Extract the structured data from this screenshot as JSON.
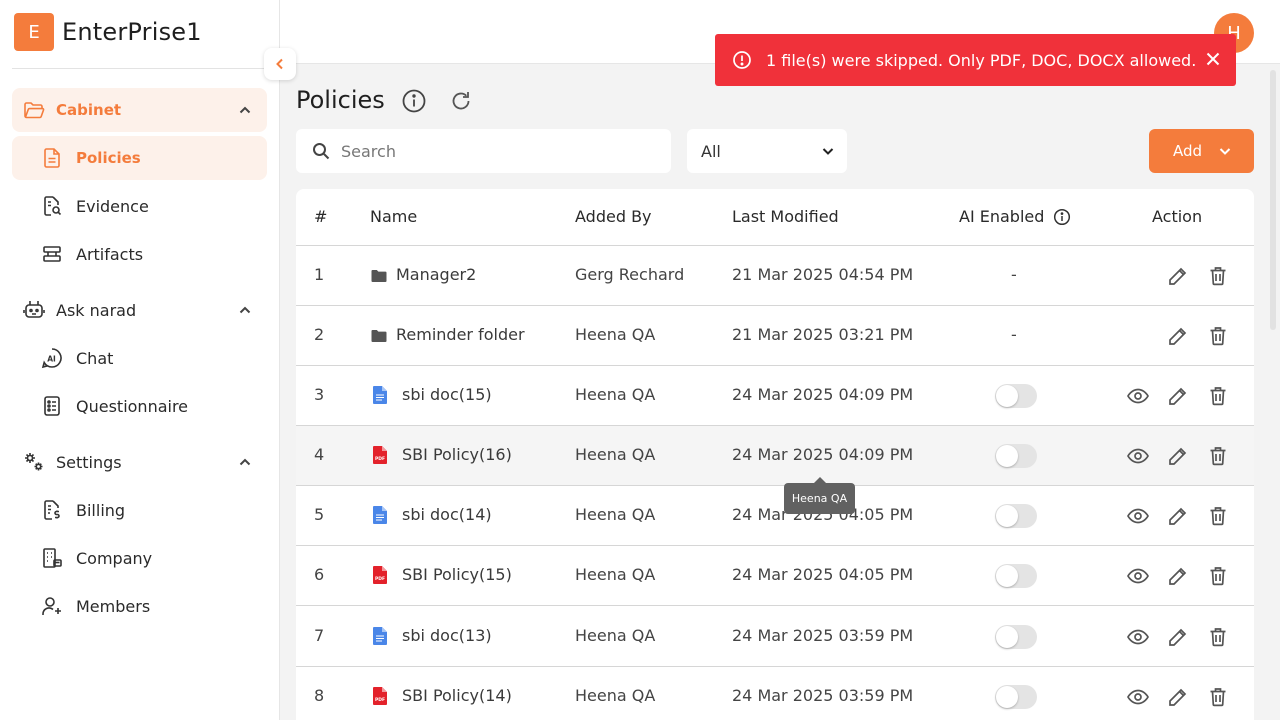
{
  "brand": {
    "logo_letter": "E",
    "name": "EnterPrise1"
  },
  "sidebar": {
    "groups": [
      {
        "label": "Cabinet",
        "items": [
          "Policies",
          "Evidence",
          "Artifacts"
        ]
      },
      {
        "label": "Ask narad",
        "items": [
          "Chat",
          "Questionnaire"
        ]
      },
      {
        "label": "Settings",
        "items": [
          "Billing",
          "Company",
          "Members"
        ]
      }
    ],
    "active_item": "Policies"
  },
  "header": {
    "avatar_letter": "H"
  },
  "toast": {
    "message": "1 file(s) were skipped. Only PDF, DOC, DOCX allowed."
  },
  "page": {
    "title": "Policies"
  },
  "filters": {
    "search_placeholder": "Search",
    "type_selected": "All",
    "add_label": "Add"
  },
  "table": {
    "columns": [
      "#",
      "Name",
      "Added By",
      "Last Modified",
      "AI Enabled",
      "Action"
    ],
    "rows": [
      {
        "num": "1",
        "type": "folder",
        "name": "Manager2",
        "added_by": "Gerg Rechard",
        "modified": "21 Mar 2025 04:54 PM",
        "ai": "-"
      },
      {
        "num": "2",
        "type": "folder",
        "name": "Reminder folder",
        "added_by": "Heena QA",
        "modified": "21 Mar 2025 03:21 PM",
        "ai": "-"
      },
      {
        "num": "3",
        "type": "doc",
        "name": "sbi doc(15)",
        "added_by": "Heena QA",
        "modified": "24 Mar 2025 04:09 PM",
        "ai": false
      },
      {
        "num": "4",
        "type": "pdf",
        "name": "SBI Policy(16)",
        "added_by": "Heena QA",
        "modified": "24 Mar 2025 04:09 PM",
        "ai": false
      },
      {
        "num": "5",
        "type": "doc",
        "name": "sbi doc(14)",
        "added_by": "Heena QA",
        "modified": "24 Mar 2025 04:05 PM",
        "ai": false
      },
      {
        "num": "6",
        "type": "pdf",
        "name": "SBI Policy(15)",
        "added_by": "Heena QA",
        "modified": "24 Mar 2025 04:05 PM",
        "ai": false
      },
      {
        "num": "7",
        "type": "doc",
        "name": "sbi doc(13)",
        "added_by": "Heena QA",
        "modified": "24 Mar 2025 03:59 PM",
        "ai": false
      },
      {
        "num": "8",
        "type": "pdf",
        "name": "SBI Policy(14)",
        "added_by": "Heena QA",
        "modified": "24 Mar 2025 03:59 PM",
        "ai": false
      }
    ]
  },
  "tooltip": {
    "text": "Heena QA"
  },
  "colors": {
    "accent": "#f47c3c",
    "toast": "#f0313a",
    "active_bg": "#fdf1ea"
  }
}
